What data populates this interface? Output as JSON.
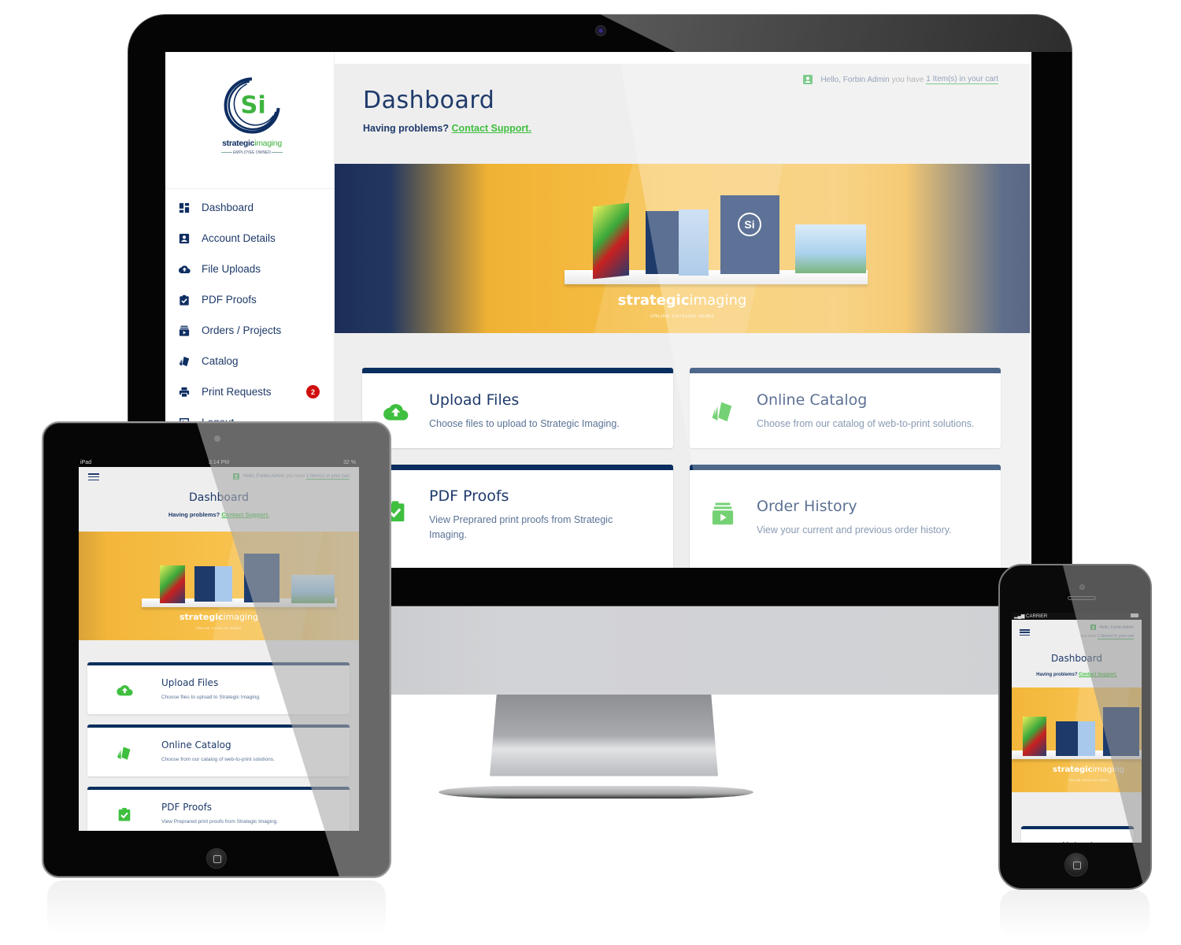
{
  "app": {
    "brand_name_bold": "strategic",
    "brand_name_light": "imaging",
    "brand_tagline": "EMPLOYEE OWNED",
    "logo_letters": "Si"
  },
  "colors": {
    "navy": "#0a2e5e",
    "text_navy": "#1e3a6a",
    "accent_green": "#3fbf3f",
    "badge_red": "#d10e0e",
    "banner_yellow": "#f7c14b",
    "background": "#eeeeee"
  },
  "sidebar": {
    "items": [
      {
        "label": "Dashboard",
        "icon": "dashboard-icon"
      },
      {
        "label": "Account Details",
        "icon": "account-box-icon"
      },
      {
        "label": "File Uploads",
        "icon": "cloud-upload-icon"
      },
      {
        "label": "PDF Proofs",
        "icon": "clipboard-check-icon"
      },
      {
        "label": "Orders / Projects",
        "icon": "orders-icon"
      },
      {
        "label": "Catalog",
        "icon": "catalog-icon"
      },
      {
        "label": "Print Requests",
        "icon": "printer-icon",
        "badge": "2"
      },
      {
        "label": "Logout",
        "icon": "logout-icon"
      }
    ]
  },
  "header": {
    "greeting_prefix": "Hello, Forbin Admin",
    "greeting_middle": "you have",
    "cart_link": "1 Item(s) in your cart",
    "title": "Dashboard",
    "help_text": "Having problems?",
    "help_link": "Contact Support."
  },
  "banner": {
    "brand_bold": "strategic",
    "brand_light": "imaging",
    "subtitle": "ONLINE CATALOG DEMO"
  },
  "cards": [
    {
      "title": "Upload Files",
      "description": "Choose files to upload to Strategic Imaging.",
      "icon": "cloud-upload-icon"
    },
    {
      "title": "Online Catalog",
      "description": "Choose from our catalog of web-to-print solutions.",
      "icon": "catalog-icon"
    },
    {
      "title": "PDF Proofs",
      "description": "View Preprared print proofs from Strategic Imaging.",
      "icon": "clipboard-check-icon"
    },
    {
      "title": "Order History",
      "description": "View your current and previous order history.",
      "icon": "orders-icon"
    }
  ],
  "tablet": {
    "status_left": "iPad",
    "status_time": "3:14 PM",
    "status_battery": "32 %"
  },
  "phone": {
    "status_carrier": "CARRIER",
    "greeting_line1": "Hello, Forbin Admin",
    "greeting_line2": "you have",
    "cart_link": "1 Item(s) in your cart",
    "card_title_partial": "Upload"
  }
}
